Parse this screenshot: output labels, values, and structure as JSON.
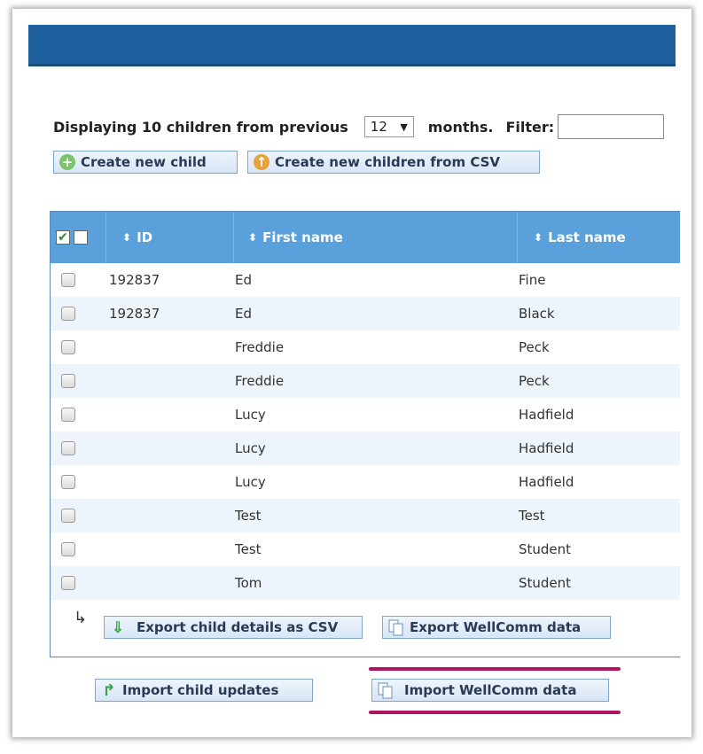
{
  "controls": {
    "display_prefix": "Displaying 10 children from previous",
    "months_value": "12",
    "months_suffix": "months.",
    "filter_label": "Filter:",
    "filter_value": ""
  },
  "buttons": {
    "create_child": "Create new child",
    "create_csv": "Create new children from CSV",
    "export_csv": "Export child details as CSV",
    "export_wellcomm": "Export WellComm data",
    "import_updates": "Import child updates",
    "import_wellcomm": "Import WellComm data"
  },
  "table": {
    "headers": {
      "id": "ID",
      "first_name": "First name",
      "last_name": "Last name"
    },
    "rows": [
      {
        "id": "192837",
        "first": "Ed",
        "last": "Fine"
      },
      {
        "id": "192837",
        "first": "Ed",
        "last": "Black"
      },
      {
        "id": "",
        "first": "Freddie",
        "last": "Peck"
      },
      {
        "id": "",
        "first": "Freddie",
        "last": "Peck"
      },
      {
        "id": "",
        "first": "Lucy",
        "last": "Hadfield"
      },
      {
        "id": "",
        "first": "Lucy",
        "last": "Hadfield"
      },
      {
        "id": "",
        "first": "Lucy",
        "last": "Hadfield"
      },
      {
        "id": "",
        "first": "Test",
        "last": "Test"
      },
      {
        "id": "",
        "first": "Test",
        "last": "Student"
      },
      {
        "id": "",
        "first": "Tom",
        "last": "Student"
      }
    ]
  },
  "icons": {
    "header": "blue-header-bar",
    "create_child": "plus-circle-icon",
    "create_csv": "up-arrow-circle-icon",
    "export_csv": "down-arrow-icon",
    "export_wellcomm": "copy-documents-icon",
    "import_updates": "arrow-up-right-icon",
    "import_wellcomm": "copy-documents-icon"
  },
  "colors": {
    "header_bar": "#1e5f9e",
    "table_header": "#5aa0db",
    "highlight": "#b0145e"
  }
}
